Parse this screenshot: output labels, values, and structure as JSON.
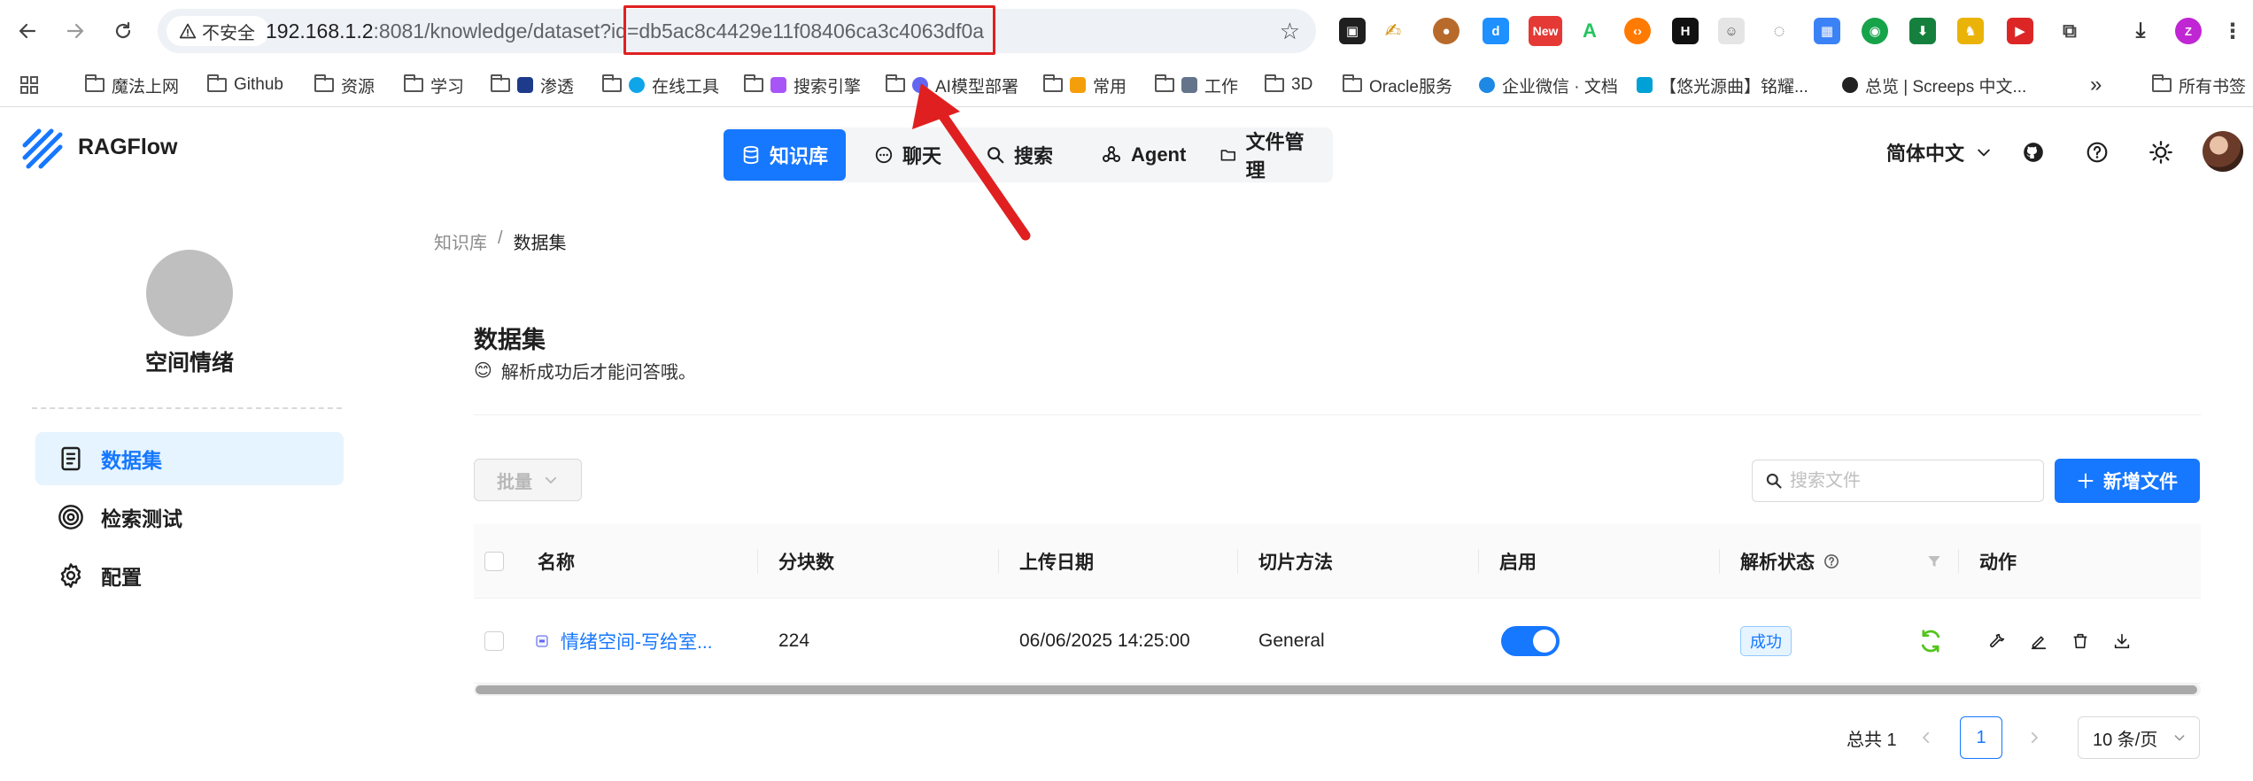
{
  "browser": {
    "security_label": "不安全",
    "url_host": "192.168.1.2",
    "url_path": ":8081/knowledge/dataset?id=db5ac8c4429e11f08406ca3c4063df0a",
    "ext_new_badge": "New"
  },
  "bookmarks": [
    {
      "label": "魔法上网",
      "kind": "folder"
    },
    {
      "label": "Github",
      "kind": "folder"
    },
    {
      "label": "资源",
      "kind": "folder"
    },
    {
      "label": "学习",
      "kind": "folder"
    },
    {
      "label": "渗透",
      "kind": "folder"
    },
    {
      "label": "在线工具",
      "kind": "folder"
    },
    {
      "label": "搜索引擎",
      "kind": "folder"
    },
    {
      "label": "AI模型部署",
      "kind": "folder"
    },
    {
      "label": "常用",
      "kind": "folder"
    },
    {
      "label": "工作",
      "kind": "folder"
    },
    {
      "label": "3D",
      "kind": "folder"
    },
    {
      "label": "Oracle服务",
      "kind": "folder"
    },
    {
      "label": "企业微信 · 文档",
      "kind": "link"
    },
    {
      "label": "【悠光源曲】铭耀...",
      "kind": "link"
    },
    {
      "label": "总览 | Screeps 中文...",
      "kind": "link"
    },
    {
      "label": "所有书签",
      "kind": "folder"
    }
  ],
  "app": {
    "brand": "RAGFlow",
    "nav": [
      {
        "label": "知识库",
        "icon": "database-icon",
        "active": true
      },
      {
        "label": "聊天",
        "icon": "chat-icon",
        "active": false
      },
      {
        "label": "搜索",
        "icon": "search-icon",
        "active": false
      },
      {
        "label": "Agent",
        "icon": "agent-icon",
        "active": false
      },
      {
        "label": "文件管理",
        "icon": "folder-icon",
        "active": false
      }
    ],
    "language": "简体中文"
  },
  "sidebar": {
    "space_name": "空间情绪",
    "items": [
      {
        "label": "数据集",
        "icon": "document-icon",
        "active": true
      },
      {
        "label": "检索测试",
        "icon": "target-icon",
        "active": false
      },
      {
        "label": "配置",
        "icon": "gear-icon",
        "active": false
      }
    ]
  },
  "breadcrumb": {
    "parent": "知识库",
    "current": "数据集"
  },
  "main": {
    "title": "数据集",
    "subtitle_emoji": "😊",
    "subtitle": "解析成功后才能问答哦。",
    "batch_label": "批量",
    "search_placeholder": "搜索文件",
    "add_label": "新增文件"
  },
  "table": {
    "columns": [
      "名称",
      "分块数",
      "上传日期",
      "切片方法",
      "启用",
      "解析状态",
      "动作"
    ],
    "rows": [
      {
        "name": "情绪空间-写给室...",
        "chunks": "224",
        "uploaded": "06/06/2025 14:25:00",
        "method": "General",
        "enabled": true,
        "status": "成功"
      }
    ]
  },
  "pagination": {
    "total": "总共 1",
    "page": "1",
    "page_size": "10 条/页"
  },
  "colors": {
    "primary": "#1677ff",
    "success": "#52c41a",
    "annotation": "#e02020"
  }
}
